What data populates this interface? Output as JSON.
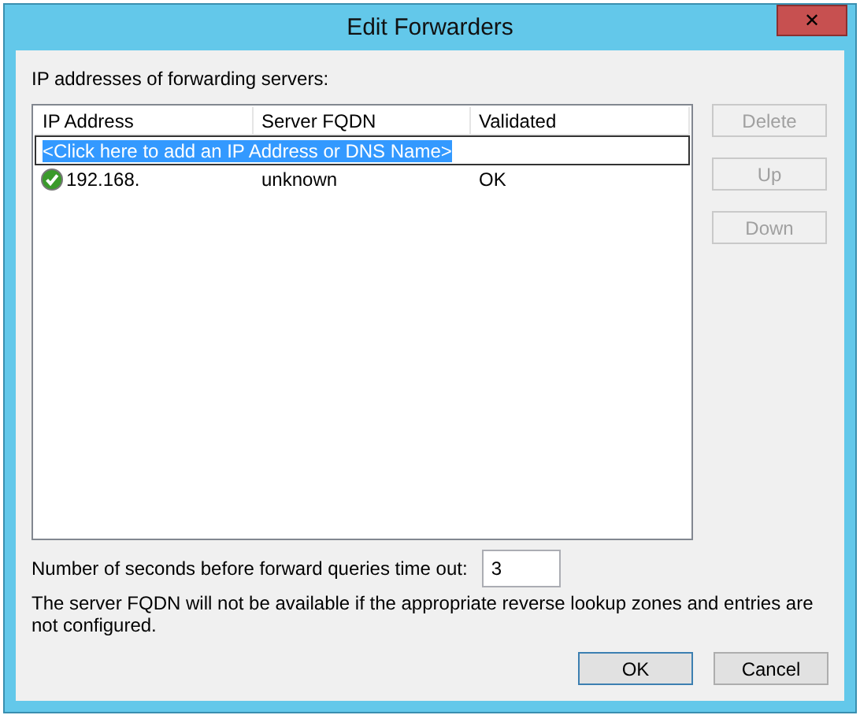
{
  "window": {
    "title": "Edit Forwarders",
    "close": "✕"
  },
  "list_label": "IP addresses of forwarding servers:",
  "table": {
    "columns": [
      "IP Address",
      "Server FQDN",
      "Validated"
    ],
    "add_row": {
      "text": "<Click here to add an IP Address or DNS Name>",
      "selected": true
    },
    "rows": [
      {
        "ip": "192.168.",
        "fqdn": "unknown",
        "validated": "OK"
      }
    ]
  },
  "side_buttons": [
    {
      "label": "Delete",
      "disabled": true
    },
    {
      "label": "Up",
      "disabled": true
    },
    {
      "label": "Down",
      "disabled": true
    }
  ],
  "timeout": {
    "label": "Number of seconds before forward queries time out:",
    "value": "3"
  },
  "note": "The server FQDN will not be available if the appropriate reverse lookup zones and entries are not configured.",
  "buttons": [
    {
      "label": "OK",
      "default": true
    },
    {
      "label": "Cancel",
      "default": false
    }
  ]
}
